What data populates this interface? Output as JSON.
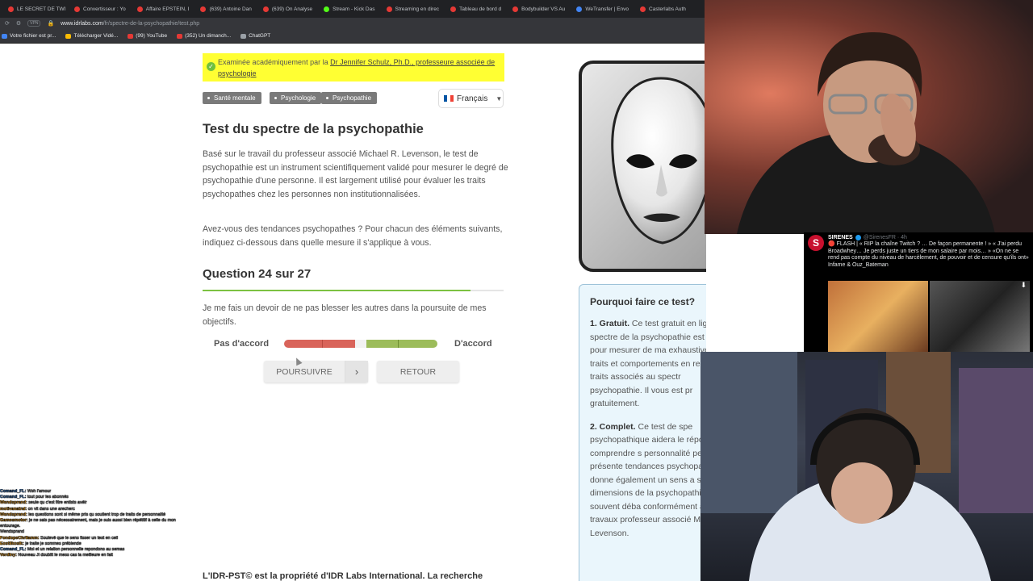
{
  "browser": {
    "tabs": [
      {
        "label": "LE SECRET DE TWI",
        "color": "#e53935"
      },
      {
        "label": "Convertisseur : Yo",
        "color": "#e53935"
      },
      {
        "label": "Affaire EPSTEIN, I",
        "color": "#e53935"
      },
      {
        "label": "(639) Antoine Dan",
        "color": "#e53935"
      },
      {
        "label": "(639) On Analyse",
        "color": "#e53935"
      },
      {
        "label": "Stream - Kick Das",
        "color": "#53fc18"
      },
      {
        "label": "Streaming en direc",
        "color": "#e53935"
      },
      {
        "label": "Tableau de bord d",
        "color": "#e53935"
      },
      {
        "label": "Bodybuilder VS Au",
        "color": "#e53935"
      },
      {
        "label": "WeTransfer | Envo",
        "color": "#4285f4"
      },
      {
        "label": "Casterlabs Auth",
        "color": "#e53935"
      }
    ],
    "vpn": "VPN",
    "url_host": "www.idrlabs.com",
    "url_path": "/fr/spectre-de-la-psychopathie/test.php",
    "bookmarks": [
      {
        "label": "Votre fichier est pr...",
        "color": "#4285f4"
      },
      {
        "label": "Télécharger Vidé...",
        "color": "#fbbc04"
      },
      {
        "label": "(99) YouTube",
        "color": "#e53935"
      },
      {
        "label": "(352) Un dimanch...",
        "color": "#e53935"
      },
      {
        "label": "ChatGPT",
        "color": "#9aa0a6"
      }
    ]
  },
  "page": {
    "review_prefix": "Examinée académiquement par la ",
    "review_link": "Dr Jennifer Schulz, Ph.D., professeure associée de psychologie",
    "tags": [
      "Santé mentale",
      "Psychologie",
      "Psychopathie"
    ],
    "language": "Français",
    "title": "Test du spectre de la psychopathie",
    "intro": "Basé sur le travail du professeur associé Michael R. Levenson, le test de psychopathie est un instrument scientifiquement validé pour mesurer le degré de psychopathie d'une personne. Il est largement utilisé pour évaluer les traits psychopathes chez les personnes non institutionnalisées.",
    "instructions": "Avez-vous des tendances psychopathes ? Pour chacun des éléments suivants, indiquez ci-dessous dans quelle mesure il s'applique à vous.",
    "question_counter": "Question 24 sur 27",
    "progress_fraction": 0.889,
    "question": "Je me fais un devoir de ne pas blesser les autres dans la poursuite de mes objectifs.",
    "scale_left": "Pas d'accord",
    "scale_right": "D'accord",
    "next_label": "POURSUIVRE",
    "back_label": "RETOUR",
    "footer": "L'IDR-PST© est la propriété d'IDR Labs International. La recherche"
  },
  "why": {
    "title": "Pourquoi faire ce test?",
    "p1_bold": "1. Gratuit.",
    "p1": " Ce test gratuit en ligne du spectre de la psychopathie est conçu pour mesurer de ma exhaustive vos traits et comportements en relation les traits associés au spectr psychopathie. Il vous est pr gratuitement.",
    "p2_bold": "2. Complet.",
    "p2": " Ce test de spe psychopathique aidera le répondant à comprendre s personnalité peut présente tendances psychopathes. L donne également un sens a sous-dimensions de la psychopathie souvent déba conformément aux travaux professeur associé Michael Levenson."
  },
  "chat": [
    {
      "user": "Comand_FL:",
      "msg": " Wsh l'amour",
      "color": "#4a90e2"
    },
    {
      "user": "Comand_FL:",
      "msg": " tout pour les abonnés",
      "color": "#4a90e2"
    },
    {
      "user": "Wendsprand:",
      "msg": " seule qu c'est fitre entists avéir",
      "color": "#f5a623"
    },
    {
      "user": "motivanatral:",
      "msg": " on vit dans une arecherc",
      "color": "#f5a623"
    },
    {
      "user": "Wendsprand:",
      "msg": " les questions sont si même pris qu soutient trop de traits de personnalité",
      "color": "#f5a623"
    },
    {
      "user": "Gamesmotor:",
      "msg": " je ne sais pas nécessairement, mais je suis aussi bien répétitif à celle du mon",
      "color": "#f5a623"
    },
    {
      "user": "",
      "msg": " entourage.",
      "color": "#fff"
    },
    {
      "user": "",
      "msg": "            Wendsprand",
      "color": "#f5a623"
    },
    {
      "user": "FondopeChrilamm:",
      "msg": " Soulevé que le sens fisser un test en ceil",
      "color": "#f5a623"
    },
    {
      "user": "Eostilkosik:",
      "msg": " je traite je sommes prébiende",
      "color": "#f5a623"
    },
    {
      "user": "Comand_FL:",
      "msg": " Moi et un relation personnelle repondons au semas",
      "color": "#4a90e2"
    },
    {
      "user": "Verdiny:",
      "msg": " Nouveau Ji doublit le mess cas la meilleure en fait",
      "color": "#f5a623"
    }
  ],
  "tweet": {
    "avatar_letter": "S",
    "name": "SIRENES",
    "handle": "@SirenesFR · 4h",
    "text": "🔴 FLASH | « RIP la chaîne Twitch ? … De façon permanente ! » « J'ai perdu Broadwhey… Je perds juste un tiers de mon salaire par mois… » «On ne se rend pas compte du niveau de harcèlement, de pouvoir et de censure qu'ils ont» Infame & Ouz_Bateman"
  }
}
